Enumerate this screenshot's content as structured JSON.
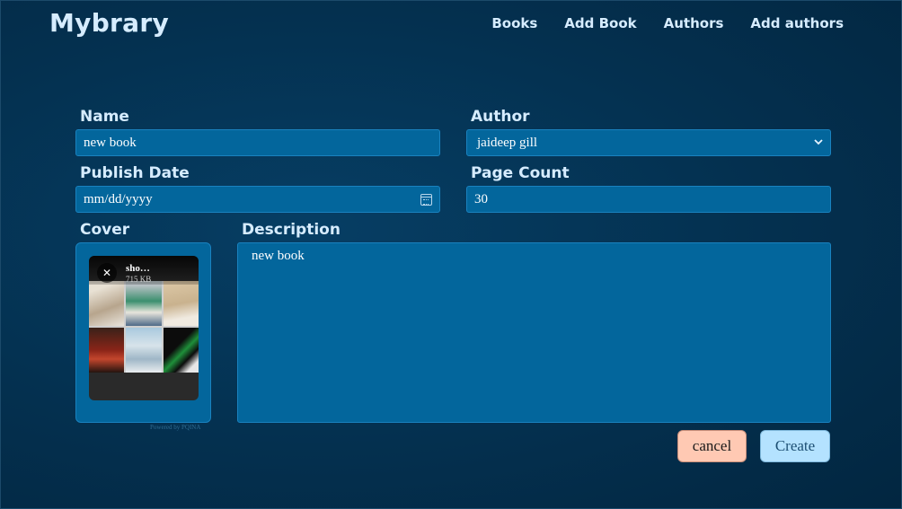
{
  "brand": "Mybrary",
  "nav": {
    "books": "Books",
    "add_book": "Add Book",
    "authors": "Authors",
    "add_authors": "Add authors"
  },
  "form": {
    "name_label": "Name",
    "name_value": "new book",
    "author_label": "Author",
    "author_value": "jaideep gill",
    "publish_label": "Publish Date",
    "publish_placeholder": "mm/dd/yyyy",
    "pagecount_label": "Page Count",
    "pagecount_value": "30",
    "cover_label": "Cover",
    "cover_file_name": "sho…",
    "cover_file_size": "715 KB",
    "powered_by": "Powered by PQINA",
    "description_label": "Description",
    "description_value": "new book",
    "cancel_label": "cancel",
    "create_label": "Create"
  },
  "colors": {
    "background": "#04304f",
    "field": "#03669c",
    "cancel_button": "#ffc9b3",
    "create_button": "#b4e2ff"
  }
}
